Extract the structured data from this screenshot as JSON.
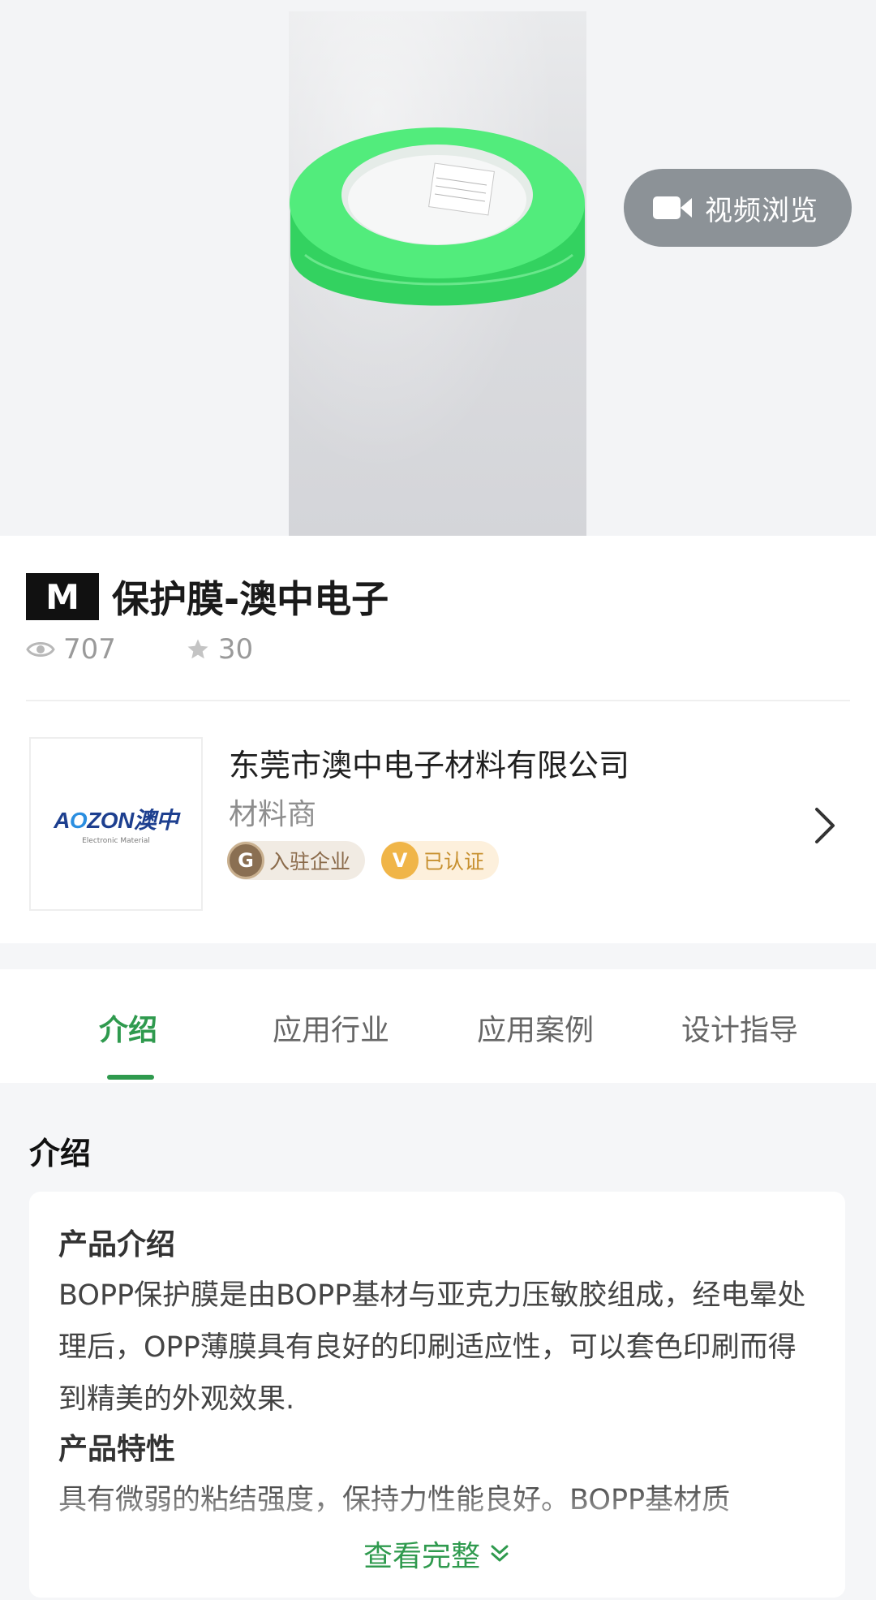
{
  "media": {
    "video_button_label": "视频浏览",
    "icon": "video-camera-icon"
  },
  "product": {
    "badge": "M",
    "title": "保护膜-澳中电子",
    "views": "707",
    "favorites": "30"
  },
  "company": {
    "logo_text_a": "A",
    "logo_text_o": "O",
    "logo_text_rest": "ZON澳中",
    "logo_sub": "Electronic Material",
    "name": "东莞市澳中电子材料有限公司",
    "type": "材料商",
    "badges": [
      {
        "icon_text": "G",
        "label": "入驻企业"
      },
      {
        "icon_text": "V",
        "label": "已认证"
      }
    ]
  },
  "tabs": [
    {
      "label": "介绍",
      "active": true
    },
    {
      "label": "应用行业",
      "active": false
    },
    {
      "label": "应用案例",
      "active": false
    },
    {
      "label": "设计指导",
      "active": false
    }
  ],
  "intro": {
    "heading": "介绍",
    "sections": [
      {
        "title": "产品介绍",
        "body": "BOPP保护膜是由BOPP基材与亚克力压敏胶组成，经电晕处理后，OPP薄膜具有良好的印刷适应性，可以套色印刷而得到精美的外观效果."
      },
      {
        "title": "产品特性",
        "body": "具有微弱的粘结强度，保持力性能良好。BOPP基材质"
      }
    ],
    "more_label": "查看完整"
  },
  "colors": {
    "accent": "#2f9a4e",
    "tape": "#3ee06a"
  }
}
